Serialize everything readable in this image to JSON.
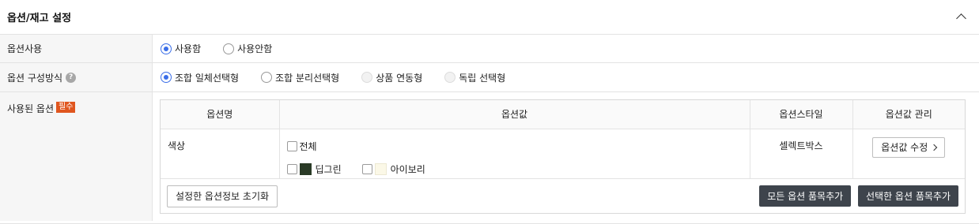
{
  "panel": {
    "title": "옵션/재고 설정"
  },
  "option_use": {
    "label": "옵션사용",
    "choices": [
      {
        "label": "사용함",
        "checked": true
      },
      {
        "label": "사용안함",
        "checked": false
      }
    ]
  },
  "option_method": {
    "label": "옵션 구성방식",
    "help": "?",
    "choices": [
      {
        "label": "조합 일체선택형",
        "checked": true,
        "disabled": false
      },
      {
        "label": "조합 분리선택형",
        "checked": false,
        "disabled": false
      },
      {
        "label": "상품 연동형",
        "checked": false,
        "disabled": true
      },
      {
        "label": "독립 선택형",
        "checked": false,
        "disabled": true
      }
    ]
  },
  "used_options": {
    "label": "사용된 옵션",
    "required": "필수",
    "table": {
      "headers": [
        "옵션명",
        "옵션값",
        "옵션스타일",
        "옵션값 관리"
      ],
      "rows": [
        {
          "name": "색상",
          "all_label": "전체",
          "values": [
            {
              "label": "딥그린",
              "color": "#2a3a26"
            },
            {
              "label": "아이보리",
              "color": "#fbf8e7"
            }
          ],
          "style": "셀렉트박스",
          "manage_label": "옵션값 수정"
        }
      ]
    },
    "reset_label": "설정한 옵션정보 초기화",
    "add_all_label": "모든 옵션 품목추가",
    "add_selected_label": "선택한 옵션 품목추가"
  },
  "icons": {
    "collapse": "chevron-up-icon",
    "manage": "chevron-right-icon",
    "help": "question-circle-icon"
  },
  "colors": {
    "accent": "#3a6ee8",
    "required_badge": "#e0561f",
    "dark_button": "#3e444c"
  }
}
